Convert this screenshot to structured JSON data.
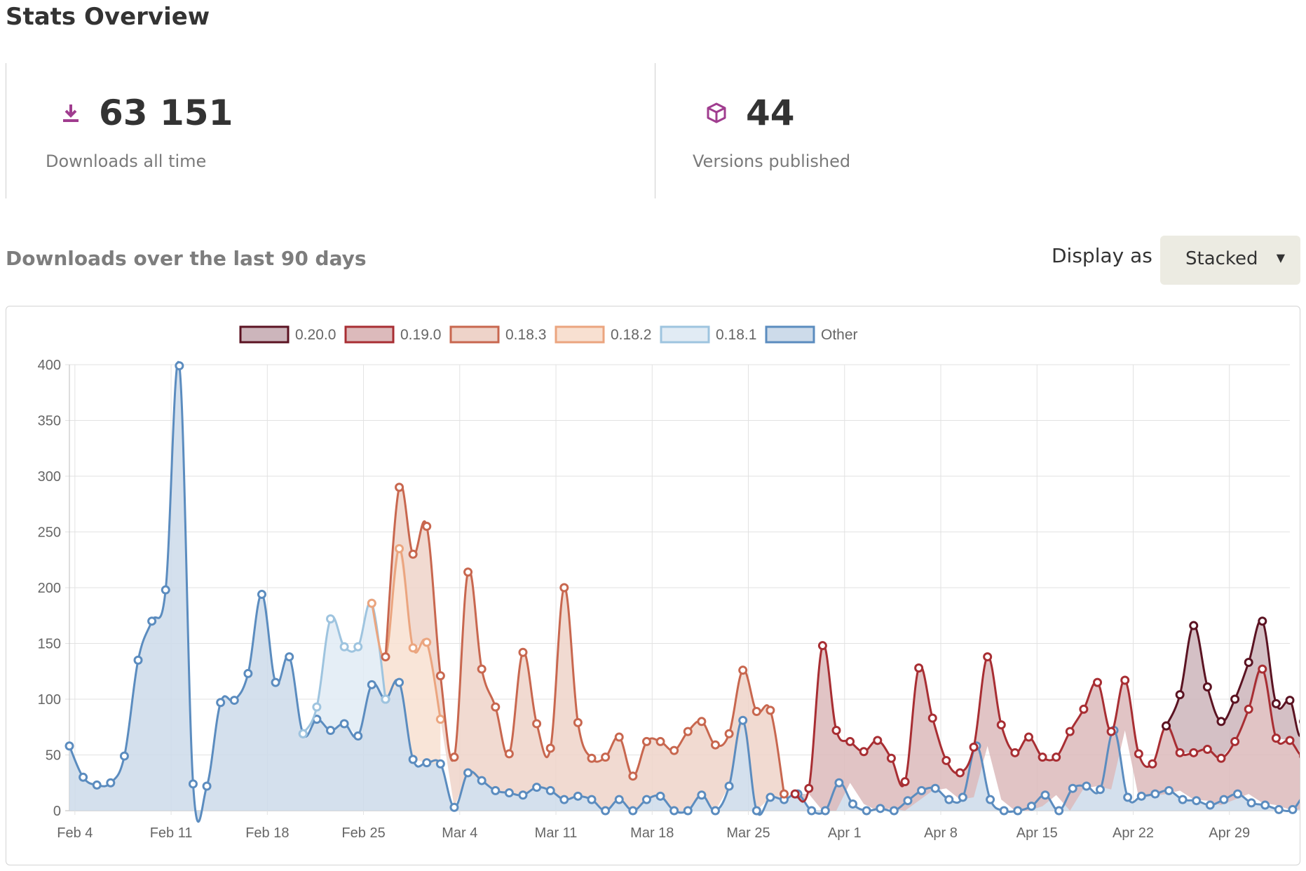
{
  "page": {
    "title": "Stats Overview"
  },
  "stats": [
    {
      "value": "63 151",
      "label": "Downloads all time",
      "icon": "download-icon"
    },
    {
      "value": "44",
      "label": "Versions published",
      "icon": "package-icon"
    }
  ],
  "colors": {
    "accent": "#a03d8f"
  },
  "downloads": {
    "title": "Downloads over the last 90 days",
    "display_label": "Display as",
    "display_value": "Stacked"
  },
  "chart_data": {
    "type": "area",
    "stacked": true,
    "title": "",
    "x_tick_labels": [
      "Feb 4",
      "Feb 11",
      "Feb 18",
      "Feb 25",
      "Mar 4",
      "Mar 11",
      "Mar 18",
      "Mar 25",
      "Apr 1",
      "Apr 8",
      "Apr 15",
      "Apr 22",
      "Apr 29"
    ],
    "x_tick_days": [
      0,
      7,
      14,
      21,
      28,
      35,
      42,
      49,
      56,
      63,
      70,
      77,
      84
    ],
    "x_range": [
      -0.4,
      88.4
    ],
    "ylim": [
      0,
      400
    ],
    "yticks": [
      0,
      50,
      100,
      150,
      200,
      250,
      300,
      350,
      400
    ],
    "grid": true,
    "legend_position": "top",
    "legend": [
      "0.20.0",
      "0.19.0",
      "0.18.3",
      "0.18.2",
      "0.18.1",
      "Other"
    ],
    "series": [
      {
        "name": "Other",
        "color": "#5b8cbf",
        "fill": "#cddbea",
        "start": -0.4,
        "values": [
          58,
          30,
          23,
          25,
          49,
          135,
          170,
          198,
          399,
          24,
          22,
          97,
          99,
          123,
          194,
          115,
          138,
          69,
          82,
          72,
          78,
          67,
          113,
          100,
          115,
          46,
          43,
          42,
          3,
          34,
          27,
          18,
          16,
          14,
          21,
          18,
          10,
          13,
          10,
          0,
          10,
          0,
          10,
          13,
          0,
          0,
          14,
          0,
          22,
          81,
          0,
          12,
          10,
          15,
          0,
          0,
          25,
          6,
          0,
          2,
          0,
          9,
          18,
          20,
          10,
          12,
          58,
          10,
          0,
          0,
          4,
          14,
          0,
          20,
          22,
          19,
          72,
          12,
          13,
          15,
          18,
          10,
          9,
          5,
          10,
          15,
          7,
          5,
          1,
          1,
          15,
          5
        ]
      },
      {
        "name": "0.18.1",
        "color": "#9ec4df",
        "fill": "#e1ebf4",
        "start": 16.6,
        "values": [
          0,
          11,
          100,
          69,
          80,
          73,
          0
        ]
      },
      {
        "name": "0.18.2",
        "color": "#eba57f",
        "fill": "#f8e0d1",
        "start": 21.6,
        "values": [
          0,
          38,
          120,
          100,
          108,
          40
        ]
      },
      {
        "name": "0.18.3",
        "color": "#c8674f",
        "fill": "#eed3c9",
        "start": 22.6,
        "values": [
          0,
          55,
          84,
          104,
          39,
          45,
          180,
          100,
          75,
          35,
          128,
          57,
          38,
          190,
          66,
          37,
          48,
          56,
          31,
          52,
          49,
          54,
          71,
          66,
          59,
          47,
          45,
          89,
          78,
          5
        ]
      },
      {
        "name": "0.19.0",
        "color": "#a82e33",
        "fill": "#dcbabb",
        "start": 52.4,
        "values": [
          0,
          5,
          148,
          72,
          37,
          47,
          63,
          45,
          26,
          119,
          65,
          25,
          24,
          45,
          80,
          67,
          52,
          66,
          44,
          34,
          71,
          71,
          93,
          52,
          45,
          39,
          29,
          61,
          34,
          42,
          46,
          42,
          52,
          76,
          120,
          60,
          62,
          48,
          48,
          46,
          43,
          33,
          34,
          48
        ]
      },
      {
        "name": "0.20.0",
        "color": "#5b1322",
        "fill": "#ccb5bb",
        "start": 79.4,
        "values": [
          0,
          52,
          114,
          56,
          33,
          38,
          42,
          43,
          31,
          36,
          31,
          31
        ]
      }
    ]
  }
}
